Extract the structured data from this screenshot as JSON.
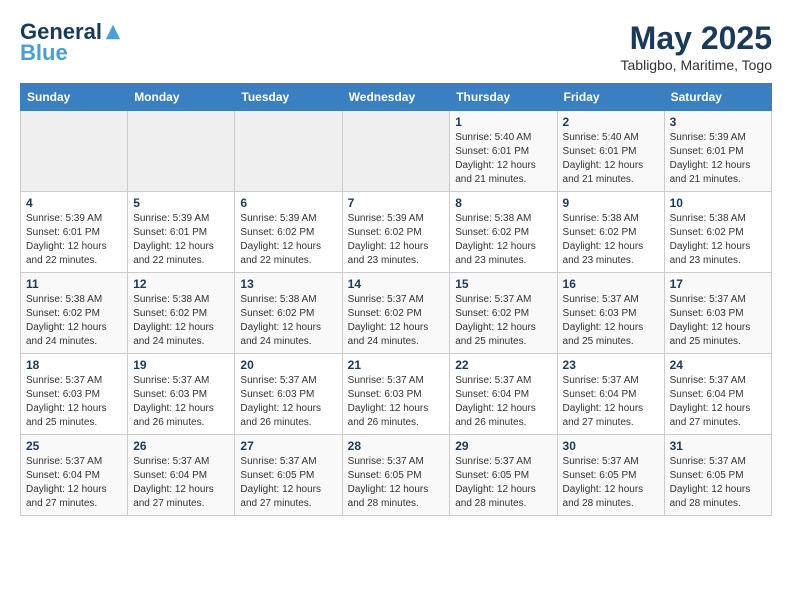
{
  "header": {
    "logo_line1": "General",
    "logo_line2": "Blue",
    "month": "May 2025",
    "location": "Tabligbo, Maritime, Togo"
  },
  "weekdays": [
    "Sunday",
    "Monday",
    "Tuesday",
    "Wednesday",
    "Thursday",
    "Friday",
    "Saturday"
  ],
  "weeks": [
    [
      {
        "day": "",
        "sunrise": "",
        "sunset": "",
        "daylight": ""
      },
      {
        "day": "",
        "sunrise": "",
        "sunset": "",
        "daylight": ""
      },
      {
        "day": "",
        "sunrise": "",
        "sunset": "",
        "daylight": ""
      },
      {
        "day": "",
        "sunrise": "",
        "sunset": "",
        "daylight": ""
      },
      {
        "day": "1",
        "sunrise": "Sunrise: 5:40 AM",
        "sunset": "Sunset: 6:01 PM",
        "daylight": "Daylight: 12 hours and 21 minutes."
      },
      {
        "day": "2",
        "sunrise": "Sunrise: 5:40 AM",
        "sunset": "Sunset: 6:01 PM",
        "daylight": "Daylight: 12 hours and 21 minutes."
      },
      {
        "day": "3",
        "sunrise": "Sunrise: 5:39 AM",
        "sunset": "Sunset: 6:01 PM",
        "daylight": "Daylight: 12 hours and 21 minutes."
      }
    ],
    [
      {
        "day": "4",
        "sunrise": "Sunrise: 5:39 AM",
        "sunset": "Sunset: 6:01 PM",
        "daylight": "Daylight: 12 hours and 22 minutes."
      },
      {
        "day": "5",
        "sunrise": "Sunrise: 5:39 AM",
        "sunset": "Sunset: 6:01 PM",
        "daylight": "Daylight: 12 hours and 22 minutes."
      },
      {
        "day": "6",
        "sunrise": "Sunrise: 5:39 AM",
        "sunset": "Sunset: 6:02 PM",
        "daylight": "Daylight: 12 hours and 22 minutes."
      },
      {
        "day": "7",
        "sunrise": "Sunrise: 5:39 AM",
        "sunset": "Sunset: 6:02 PM",
        "daylight": "Daylight: 12 hours and 23 minutes."
      },
      {
        "day": "8",
        "sunrise": "Sunrise: 5:38 AM",
        "sunset": "Sunset: 6:02 PM",
        "daylight": "Daylight: 12 hours and 23 minutes."
      },
      {
        "day": "9",
        "sunrise": "Sunrise: 5:38 AM",
        "sunset": "Sunset: 6:02 PM",
        "daylight": "Daylight: 12 hours and 23 minutes."
      },
      {
        "day": "10",
        "sunrise": "Sunrise: 5:38 AM",
        "sunset": "Sunset: 6:02 PM",
        "daylight": "Daylight: 12 hours and 23 minutes."
      }
    ],
    [
      {
        "day": "11",
        "sunrise": "Sunrise: 5:38 AM",
        "sunset": "Sunset: 6:02 PM",
        "daylight": "Daylight: 12 hours and 24 minutes."
      },
      {
        "day": "12",
        "sunrise": "Sunrise: 5:38 AM",
        "sunset": "Sunset: 6:02 PM",
        "daylight": "Daylight: 12 hours and 24 minutes."
      },
      {
        "day": "13",
        "sunrise": "Sunrise: 5:38 AM",
        "sunset": "Sunset: 6:02 PM",
        "daylight": "Daylight: 12 hours and 24 minutes."
      },
      {
        "day": "14",
        "sunrise": "Sunrise: 5:37 AM",
        "sunset": "Sunset: 6:02 PM",
        "daylight": "Daylight: 12 hours and 24 minutes."
      },
      {
        "day": "15",
        "sunrise": "Sunrise: 5:37 AM",
        "sunset": "Sunset: 6:02 PM",
        "daylight": "Daylight: 12 hours and 25 minutes."
      },
      {
        "day": "16",
        "sunrise": "Sunrise: 5:37 AM",
        "sunset": "Sunset: 6:03 PM",
        "daylight": "Daylight: 12 hours and 25 minutes."
      },
      {
        "day": "17",
        "sunrise": "Sunrise: 5:37 AM",
        "sunset": "Sunset: 6:03 PM",
        "daylight": "Daylight: 12 hours and 25 minutes."
      }
    ],
    [
      {
        "day": "18",
        "sunrise": "Sunrise: 5:37 AM",
        "sunset": "Sunset: 6:03 PM",
        "daylight": "Daylight: 12 hours and 25 minutes."
      },
      {
        "day": "19",
        "sunrise": "Sunrise: 5:37 AM",
        "sunset": "Sunset: 6:03 PM",
        "daylight": "Daylight: 12 hours and 26 minutes."
      },
      {
        "day": "20",
        "sunrise": "Sunrise: 5:37 AM",
        "sunset": "Sunset: 6:03 PM",
        "daylight": "Daylight: 12 hours and 26 minutes."
      },
      {
        "day": "21",
        "sunrise": "Sunrise: 5:37 AM",
        "sunset": "Sunset: 6:03 PM",
        "daylight": "Daylight: 12 hours and 26 minutes."
      },
      {
        "day": "22",
        "sunrise": "Sunrise: 5:37 AM",
        "sunset": "Sunset: 6:04 PM",
        "daylight": "Daylight: 12 hours and 26 minutes."
      },
      {
        "day": "23",
        "sunrise": "Sunrise: 5:37 AM",
        "sunset": "Sunset: 6:04 PM",
        "daylight": "Daylight: 12 hours and 27 minutes."
      },
      {
        "day": "24",
        "sunrise": "Sunrise: 5:37 AM",
        "sunset": "Sunset: 6:04 PM",
        "daylight": "Daylight: 12 hours and 27 minutes."
      }
    ],
    [
      {
        "day": "25",
        "sunrise": "Sunrise: 5:37 AM",
        "sunset": "Sunset: 6:04 PM",
        "daylight": "Daylight: 12 hours and 27 minutes."
      },
      {
        "day": "26",
        "sunrise": "Sunrise: 5:37 AM",
        "sunset": "Sunset: 6:04 PM",
        "daylight": "Daylight: 12 hours and 27 minutes."
      },
      {
        "day": "27",
        "sunrise": "Sunrise: 5:37 AM",
        "sunset": "Sunset: 6:05 PM",
        "daylight": "Daylight: 12 hours and 27 minutes."
      },
      {
        "day": "28",
        "sunrise": "Sunrise: 5:37 AM",
        "sunset": "Sunset: 6:05 PM",
        "daylight": "Daylight: 12 hours and 28 minutes."
      },
      {
        "day": "29",
        "sunrise": "Sunrise: 5:37 AM",
        "sunset": "Sunset: 6:05 PM",
        "daylight": "Daylight: 12 hours and 28 minutes."
      },
      {
        "day": "30",
        "sunrise": "Sunrise: 5:37 AM",
        "sunset": "Sunset: 6:05 PM",
        "daylight": "Daylight: 12 hours and 28 minutes."
      },
      {
        "day": "31",
        "sunrise": "Sunrise: 5:37 AM",
        "sunset": "Sunset: 6:05 PM",
        "daylight": "Daylight: 12 hours and 28 minutes."
      }
    ]
  ]
}
